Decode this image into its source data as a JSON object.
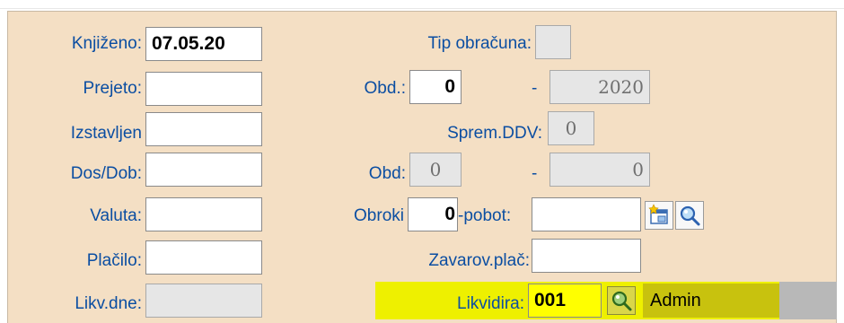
{
  "left": {
    "knjizeno_label": "Knjiženo:",
    "knjizeno_value": "07.05.20",
    "prejeto_label": "Prejeto:",
    "prejeto_value": "",
    "izstavljen_label": "Izstavljen",
    "izstavljen_value": "",
    "dosdob_label": "Dos/Dob:",
    "dosdob_value": "",
    "valuta_label": "Valuta:",
    "valuta_value": "",
    "placilo_label": "Plačilo:",
    "placilo_value": "",
    "likvdne_label": "Likv.dne:",
    "likvdne_value": ""
  },
  "right": {
    "tip_obracuna_label": "Tip obračuna:",
    "tip_obracuna_value": "",
    "obd1_label": "Obd.:",
    "obd1_from": "0",
    "obd1_dash": "-",
    "obd1_year": "2020",
    "sprem_ddv_label": "Sprem.DDV:",
    "sprem_ddv_value": "0",
    "obd2_label": "Obd:",
    "obd2_from": "0",
    "obd2_dash": "-",
    "obd2_to": "0",
    "obroki_label": "Obroki",
    "obroki_value": "0",
    "pobot_label": "-pobot:",
    "pobot_value": "",
    "zavarov_label": "Zavarov.plač:",
    "zavarov_value": "",
    "likvidira_label": "Likvidira:",
    "likvidira_value": "001",
    "likvidira_name": "Admin"
  },
  "icons": {
    "new_entry": "new-window-icon",
    "search": "magnifier-icon"
  },
  "colors": {
    "panel": "#f4dfc4",
    "label": "#0b4ea2",
    "highlight": "#eef000"
  }
}
